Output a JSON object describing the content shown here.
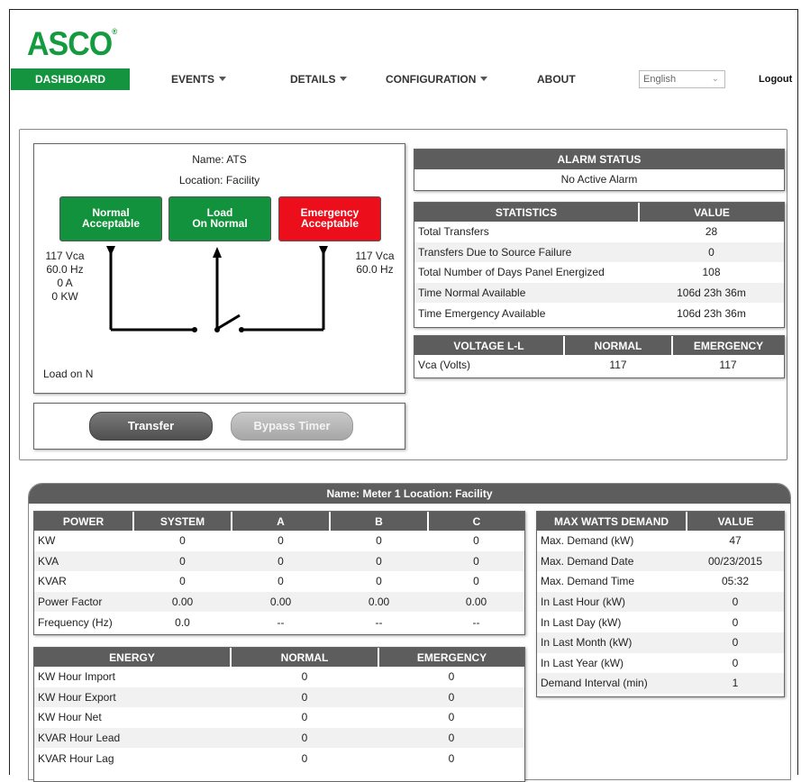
{
  "brand": {
    "logo": "ASCO",
    "mark": "®"
  },
  "nav": {
    "dashboard": "DASHBOARD",
    "events": "EVENTS",
    "details": "DETAILS",
    "configuration": "CONFIGURATION",
    "about": "ABOUT",
    "language": "English",
    "logout": "Logout"
  },
  "ats": {
    "name": "Name: ATS",
    "location": "Location: Facility",
    "normal_label_1": "Normal",
    "normal_label_2": "Acceptable",
    "load_label_1": "Load",
    "load_label_2": "On Normal",
    "emergency_label_1": "Emergency",
    "emergency_label_2": "Acceptable",
    "normal_readings": [
      "117 Vca",
      "60.0 Hz",
      "0 A",
      "0 KW"
    ],
    "emergency_readings": [
      "117 Vca",
      "60.0 Hz"
    ],
    "load_status": "Load on N",
    "colors": {
      "green": "#12923c",
      "red": "#ec0f1b"
    }
  },
  "buttons": {
    "transfer": "Transfer",
    "bypass_timer": "Bypass Timer"
  },
  "alarm": {
    "header": "ALARM STATUS",
    "status": "No Active Alarm"
  },
  "statistics": {
    "headers": [
      "STATISTICS",
      "VALUE"
    ],
    "rows": [
      [
        "Total Transfers",
        "28"
      ],
      [
        "Transfers Due to Source Failure",
        "0"
      ],
      [
        "Total Number of Days Panel Energized",
        "108"
      ],
      [
        "Time Normal Available",
        "106d 23h 36m"
      ],
      [
        "Time Emergency Available",
        "106d 23h 36m"
      ]
    ]
  },
  "voltage": {
    "headers": [
      "VOLTAGE L-L",
      "NORMAL",
      "EMERGENCY"
    ],
    "rows": [
      [
        "Vca (Volts)",
        "117",
        "117"
      ]
    ]
  },
  "meter": {
    "title": "Name: Meter 1  Location: Facility",
    "power": {
      "headers": [
        "POWER",
        "SYSTEM",
        "A",
        "B",
        "C"
      ],
      "rows": [
        [
          "KW",
          "0",
          "0",
          "0",
          "0"
        ],
        [
          "KVA",
          "0",
          "0",
          "0",
          "0"
        ],
        [
          "KVAR",
          "0",
          "0",
          "0",
          "0"
        ],
        [
          "Power Factor",
          "0.00",
          "0.00",
          "0.00",
          "0.00"
        ],
        [
          "Frequency (Hz)",
          "0.0",
          "--",
          "--",
          "--"
        ]
      ]
    },
    "energy": {
      "headers": [
        "ENERGY",
        "NORMAL",
        "EMERGENCY"
      ],
      "rows": [
        [
          "KW Hour Import",
          "0",
          "0"
        ],
        [
          "KW Hour Export",
          "0",
          "0"
        ],
        [
          "KW Hour Net",
          "0",
          "0"
        ],
        [
          "KVAR Hour Lead",
          "0",
          "0"
        ],
        [
          "KVAR Hour Lag",
          "0",
          "0"
        ]
      ]
    },
    "demand": {
      "headers": [
        "MAX WATTS DEMAND",
        "VALUE"
      ],
      "rows": [
        [
          "Max. Demand (kW)",
          "47"
        ],
        [
          "Max. Demand Date",
          "00/23/2015"
        ],
        [
          "Max. Demand Time",
          "05:32"
        ],
        [
          "In Last Hour (kW)",
          "0"
        ],
        [
          "In Last Day (kW)",
          "0"
        ],
        [
          "In Last Month (kW)",
          "0"
        ],
        [
          "In Last Year (kW)",
          "0"
        ],
        [
          "Demand Interval (min)",
          "1"
        ]
      ]
    }
  }
}
